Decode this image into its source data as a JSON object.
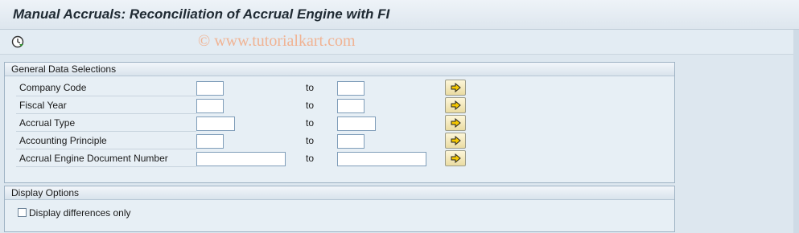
{
  "window": {
    "title": "Manual Accruals: Reconciliation of Accrual Engine with FI"
  },
  "toolbar": {
    "execute_icon": "execute-clock-icon"
  },
  "watermark": "© www.tutorialkart.com",
  "general_data": {
    "header": "General Data Selections",
    "to_label": "to",
    "rows": [
      {
        "label": "Company Code",
        "from_value": "",
        "to_value": ""
      },
      {
        "label": "Fiscal Year",
        "from_value": "",
        "to_value": ""
      },
      {
        "label": "Accrual Type",
        "from_value": "",
        "to_value": ""
      },
      {
        "label": "Accounting Principle",
        "from_value": "",
        "to_value": ""
      },
      {
        "label": "Accrual Engine Document Number",
        "from_value": "",
        "to_value": ""
      }
    ]
  },
  "display_options": {
    "header": "Display Options",
    "checkbox_label": "Display differences only",
    "checked": false
  },
  "colors": {
    "background": "#dde7ef",
    "watermark": "#f0b393",
    "button": "#eadca2"
  }
}
